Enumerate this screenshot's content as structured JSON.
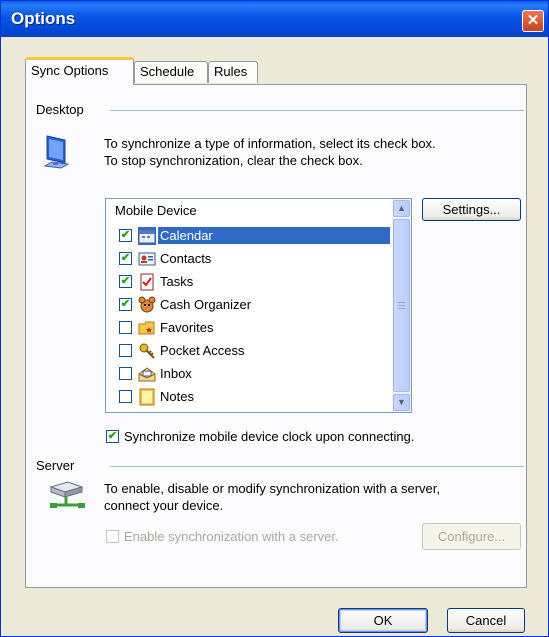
{
  "window": {
    "title": "Options",
    "close_symbol": "✕"
  },
  "tabs": [
    {
      "label": "Sync Options",
      "active": true
    },
    {
      "label": "Schedule",
      "active": false
    },
    {
      "label": "Rules",
      "active": false
    }
  ],
  "desktop": {
    "group_label": "Desktop",
    "instruction_line1": "To synchronize a type of information, select its check box.",
    "instruction_line2": "To stop synchronization, clear the check box.",
    "icon": "desktop-computer-icon",
    "settings_button": "Settings...",
    "list": {
      "header": "Mobile Device",
      "items": [
        {
          "label": "Calendar",
          "checked": true,
          "selected": true,
          "icon": "calendar-icon"
        },
        {
          "label": "Contacts",
          "checked": true,
          "selected": false,
          "icon": "contacts-icon"
        },
        {
          "label": "Tasks",
          "checked": true,
          "selected": false,
          "icon": "tasks-icon"
        },
        {
          "label": "Cash Organizer",
          "checked": true,
          "selected": false,
          "icon": "cash-organizer-icon"
        },
        {
          "label": "Favorites",
          "checked": false,
          "selected": false,
          "icon": "favorites-folder-icon"
        },
        {
          "label": "Pocket Access",
          "checked": false,
          "selected": false,
          "icon": "key-icon"
        },
        {
          "label": "Inbox",
          "checked": false,
          "selected": false,
          "icon": "inbox-icon"
        },
        {
          "label": "Notes",
          "checked": false,
          "selected": false,
          "icon": "notes-icon"
        }
      ]
    },
    "clock_sync_label": "Synchronize mobile device clock upon connecting.",
    "clock_sync_checked": true
  },
  "server": {
    "group_label": "Server",
    "icon": "network-server-icon",
    "instruction_line1": "To enable, disable or modify synchronization with a server,",
    "instruction_line2": "connect your device.",
    "enable_label": "Enable synchronization with a server.",
    "enable_checked": false,
    "configure_button": "Configure..."
  },
  "footer": {
    "ok_button": "OK",
    "cancel_button": "Cancel"
  },
  "colors": {
    "titlebar": "#0a58e4",
    "selection": "#316ac5",
    "check": "#21a121",
    "tab_highlight": "#ffc83c"
  }
}
